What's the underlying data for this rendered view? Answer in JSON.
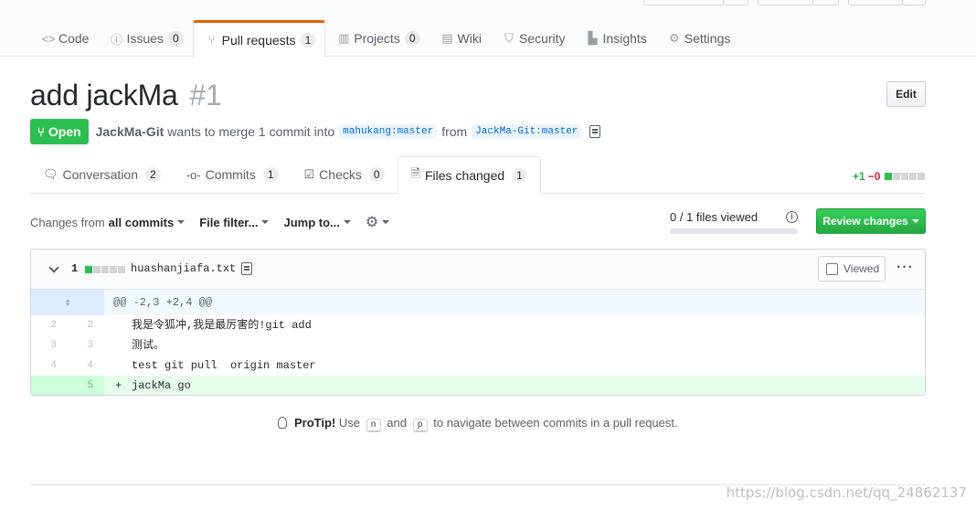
{
  "repo_nav": {
    "tabs": [
      {
        "label": "Code",
        "icon": "code-icon",
        "glyph": "<>",
        "counter": ""
      },
      {
        "label": "Issues",
        "icon": "issue-icon",
        "glyph": "ⓘ",
        "counter": "0"
      },
      {
        "label": "Pull requests",
        "icon": "git-pull-request-icon",
        "glyph": "⑂",
        "counter": "1"
      },
      {
        "label": "Projects",
        "icon": "project-icon",
        "glyph": "▥",
        "counter": "0"
      },
      {
        "label": "Wiki",
        "icon": "book-icon",
        "glyph": "▤",
        "counter": ""
      },
      {
        "label": "Security",
        "icon": "shield-icon",
        "glyph": "⛉",
        "counter": ""
      },
      {
        "label": "Insights",
        "icon": "graph-icon",
        "glyph": "▙",
        "counter": ""
      },
      {
        "label": "Settings",
        "icon": "gear-icon",
        "glyph": "⚙",
        "counter": ""
      }
    ],
    "selected": "Pull requests"
  },
  "pr": {
    "title": "add jackMa",
    "number": "#1",
    "edit_label": "Edit",
    "state": "Open",
    "author": "JackMa-Git",
    "merge_text": "wants to merge 1 commit into",
    "base_branch": "mahukang:master",
    "from_text": "from",
    "head_branch": "JackMa-Git:master"
  },
  "pr_tabs": {
    "tabs": [
      {
        "label": "Conversation",
        "icon": "comment-discussion-icon",
        "glyph": "🗨",
        "counter": "2"
      },
      {
        "label": "Commits",
        "icon": "git-commit-icon",
        "glyph": "-o-",
        "counter": "1"
      },
      {
        "label": "Checks",
        "icon": "checklist-icon",
        "glyph": "☑",
        "counter": "0"
      },
      {
        "label": "Files changed",
        "icon": "file-diff-icon",
        "glyph": "🗎",
        "counter": "1"
      }
    ],
    "selected": "Files changed"
  },
  "diffstat": {
    "additions": "+1",
    "deletions": "−0"
  },
  "toolbar": {
    "changes_from_label": "Changes from",
    "changes_from_value": "all commits",
    "file_filter": "File filter...",
    "jump_to": "Jump to...",
    "viewed_count": "0 / 1 files viewed",
    "viewed_progress": 0,
    "review_button": "Review changes"
  },
  "file": {
    "changes": "1",
    "name": "huashanjiafa.txt",
    "viewed_label": "Viewed",
    "hunk_header": "@@ -2,3 +2,4 @@",
    "lines": [
      {
        "old": "2",
        "new": "2",
        "marker": " ",
        "text": "我是令狐冲,我是最厉害的!git add",
        "type": "context"
      },
      {
        "old": "3",
        "new": "3",
        "marker": " ",
        "text": "测试。",
        "type": "context"
      },
      {
        "old": "4",
        "new": "4",
        "marker": " ",
        "text": "test git pull  origin master",
        "type": "context"
      },
      {
        "old": "",
        "new": "5",
        "marker": "+",
        "text": "jackMa go",
        "type": "addition"
      }
    ]
  },
  "protip": {
    "strong": "ProTip!",
    "pre": "Use",
    "key1": "n",
    "mid": "and",
    "key2": "p",
    "post": "to navigate between commits in a pull request."
  },
  "watermark": "https://blog.csdn.net/qq_24862137",
  "colors": {
    "accent_tab": "#e36209",
    "open_green": "#2cbe4e",
    "link_blue": "#0366d6",
    "add_bg": "#e6ffed"
  }
}
